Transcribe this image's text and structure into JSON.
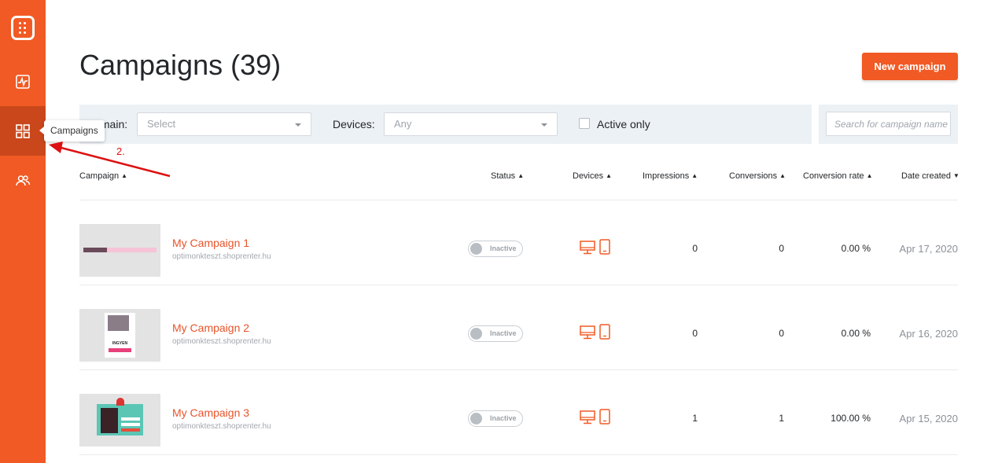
{
  "sidebar": {
    "tooltip": "Campaigns",
    "items": [
      {
        "name": "logo",
        "icon": "logo-icon"
      },
      {
        "name": "analytics",
        "icon": "activity-icon"
      },
      {
        "name": "campaigns",
        "icon": "grid-icon",
        "active": true
      },
      {
        "name": "subscribers",
        "icon": "users-icon"
      }
    ]
  },
  "annotation": {
    "step": "2."
  },
  "header": {
    "title": "Campaigns (39)",
    "new_campaign_label": "New campaign"
  },
  "filters": {
    "domain_label": "Domain:",
    "domain_value": "Select",
    "devices_label": "Devices:",
    "devices_value": "Any",
    "active_only_label": "Active only",
    "search_placeholder": "Search for campaign name"
  },
  "table": {
    "columns": {
      "campaign": "Campaign",
      "status": "Status",
      "devices": "Devices",
      "impressions": "Impressions",
      "conversions": "Conversions",
      "conversion_rate": "Conversion rate",
      "date_created": "Date created"
    },
    "rows": [
      {
        "name": "My Campaign 1",
        "domain": "optimonkteszt.shoprenter.hu",
        "status": "Inactive",
        "impressions": "0",
        "conversions": "0",
        "conversion_rate": "0.00 %",
        "date": "Apr 17, 2020"
      },
      {
        "name": "My Campaign 2",
        "domain": "optimonkteszt.shoprenter.hu",
        "status": "Inactive",
        "impressions": "0",
        "conversions": "0",
        "conversion_rate": "0.00 %",
        "date": "Apr 16, 2020",
        "thumb_text": "INGYEN"
      },
      {
        "name": "My Campaign 3",
        "domain": "optimonkteszt.shoprenter.hu",
        "status": "Inactive",
        "impressions": "1",
        "conversions": "1",
        "conversion_rate": "100.00 %",
        "date": "Apr 15, 2020"
      }
    ]
  },
  "colors": {
    "brand": "#f15a24",
    "link": "#e8542a",
    "annotation": "#dd1111"
  }
}
